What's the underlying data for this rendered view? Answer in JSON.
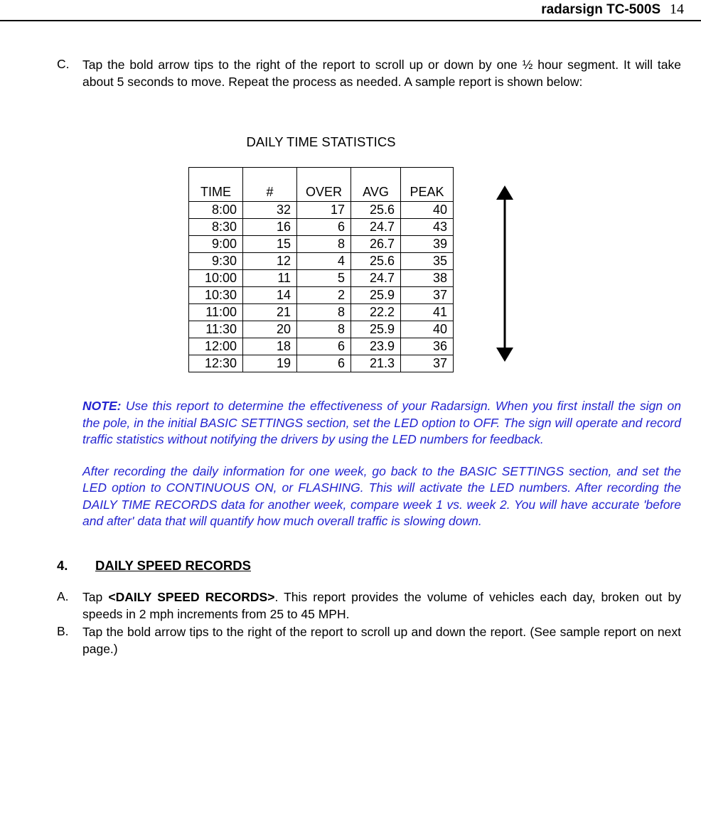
{
  "header": {
    "title": "radarsign TC-500S",
    "page": "14"
  },
  "itemC": {
    "marker": "C.",
    "text": "Tap the bold arrow tips to the right of the report to scroll up or down by one ½ hour segment.  It will take about 5 seconds to move.  Repeat the process as needed.  A sample report is shown below:"
  },
  "table": {
    "title": "DAILY TIME STATISTICS",
    "headers": [
      "TIME",
      "#",
      "OVER",
      "AVG",
      "PEAK"
    ],
    "rows": [
      [
        "8:00",
        "32",
        "17",
        "25.6",
        "40"
      ],
      [
        "8:30",
        "16",
        "6",
        "24.7",
        "43"
      ],
      [
        "9:00",
        "15",
        "8",
        "26.7",
        "39"
      ],
      [
        "9:30",
        "12",
        "4",
        "25.6",
        "35"
      ],
      [
        "10:00",
        "11",
        "5",
        "24.7",
        "38"
      ],
      [
        "10:30",
        "14",
        "2",
        "25.9",
        "37"
      ],
      [
        "11:00",
        "21",
        "8",
        "22.2",
        "41"
      ],
      [
        "11:30",
        "20",
        "8",
        "25.9",
        "40"
      ],
      [
        "12:00",
        "18",
        "6",
        "23.9",
        "36"
      ],
      [
        "12:30",
        "19",
        "6",
        "21.3",
        "37"
      ]
    ]
  },
  "note": {
    "label": "NOTE:",
    "p1": "  Use this report to determine the effectiveness of your Radarsign.  When you first install the sign on the pole, in the initial BASIC SETTINGS section, set the LED option to OFF.  The sign will operate and record traffic statistics without notifying the drivers by using the LED numbers for feedback.",
    "p2": "After recording the daily information for one week, go back to the BASIC SETTINGS section, and set the LED option to CONTINUOUS ON, or FLASHING.  This will activate the LED numbers.  After recording the DAILY TIME RECORDS data for another week, compare week 1 vs. week 2.  You will have accurate 'before and after' data that will quantify how much overall traffic is slowing down."
  },
  "section4": {
    "num": "4.",
    "title": "DAILY SPEED RECORDS"
  },
  "items4": {
    "A": {
      "marker": "A.",
      "prefix": "Tap ",
      "bold": "<DAILY SPEED RECORDS>",
      "suffix": ".  This report provides the volume of vehicles each day, broken out by speeds in 2 mph increments from 25 to 45 MPH."
    },
    "B": {
      "marker": "B.",
      "text": "Tap the bold arrow tips to the right of the report to scroll up and down the report.  (See sample report on next page.)"
    }
  }
}
